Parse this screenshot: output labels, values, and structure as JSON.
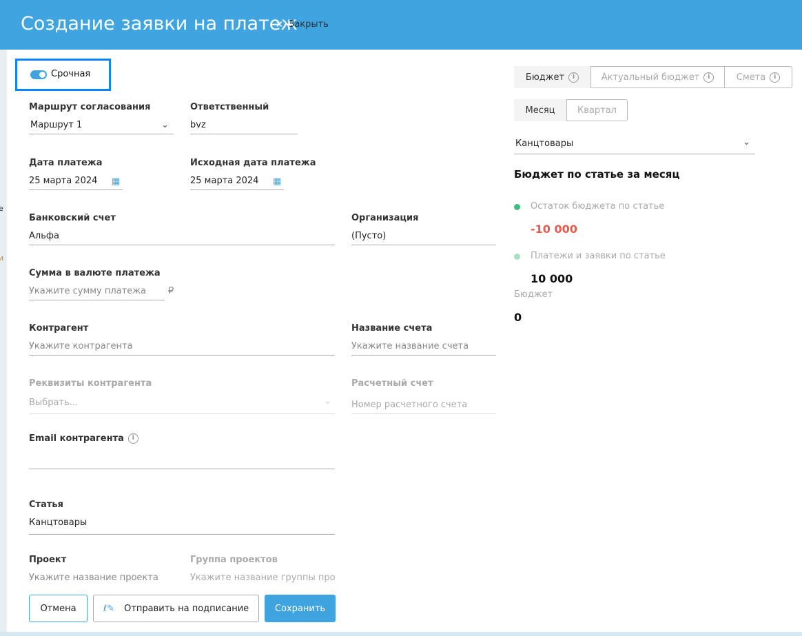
{
  "header": {
    "title": "Создание заявки на платеж",
    "close_label": "Закрыть"
  },
  "sidebar_fragments": [
    "е",
    "и"
  ],
  "urgent": {
    "label": "Срочная",
    "on": true
  },
  "form": {
    "route": {
      "label": "Маршрут согласования",
      "value": "Маршрут 1"
    },
    "responsible": {
      "label": "Ответственный",
      "value": "bvz"
    },
    "payment_date": {
      "label": "Дата платежа",
      "value": "25 марта 2024"
    },
    "original_date": {
      "label": "Исходная дата платежа",
      "value": "25 марта 2024"
    },
    "bank_account": {
      "label": "Банковский счет",
      "value": "Альфа"
    },
    "organization": {
      "label": "Организация",
      "value": "(Пусто)"
    },
    "amount": {
      "label": "Сумма в валюте платежа",
      "placeholder": "Укажите сумму платежа",
      "currency": "₽"
    },
    "counterparty": {
      "label": "Контрагент",
      "placeholder": "Укажите контрагента"
    },
    "invoice_name": {
      "label": "Название счета",
      "placeholder": "Укажите название счета"
    },
    "cp_details": {
      "label": "Реквизиты контрагента",
      "placeholder": "Выбрать..."
    },
    "settlement": {
      "label": "Расчетный счет",
      "placeholder": "Номер расчетного счета"
    },
    "email": {
      "label": "Email контрагента",
      "value": ""
    },
    "article": {
      "label": "Статья",
      "value": "Канцтовары"
    },
    "project": {
      "label": "Проект",
      "placeholder": "Укажите название проекта"
    },
    "project_group": {
      "label": "Группа проектов",
      "placeholder": "Укажите название группы проек"
    }
  },
  "buttons": {
    "cancel": "Отмена",
    "send": "Отправить на подписание",
    "save": "Сохранить"
  },
  "budget": {
    "tabs": [
      "Бюджет",
      "Актуальный бюджет",
      "Смета"
    ],
    "period_tabs": [
      "Месяц",
      "Квартал"
    ],
    "article": "Канцтовары",
    "heading": "Бюджет по статье за месяц",
    "remainder_label": "Остаток бюджета по статье",
    "remainder_value": "-10 000",
    "payments_label": "Платежи и заявки по статье",
    "payments_value": "10 000",
    "budget_label": "Бюджет",
    "budget_value": "0",
    "colors": {
      "remainder": "#3cbf7c",
      "payments": "#a6e0c2",
      "negative": "#e85a4f"
    }
  }
}
